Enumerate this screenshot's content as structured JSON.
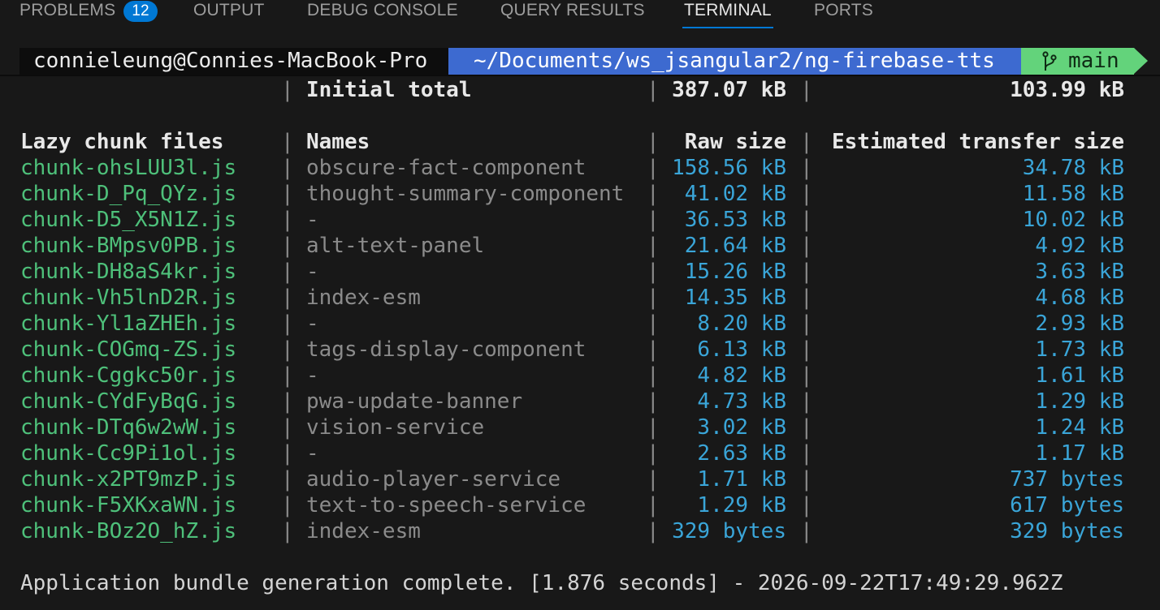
{
  "panel": {
    "tabs": [
      {
        "label": "PROBLEMS",
        "badge": "12",
        "active": false
      },
      {
        "label": "OUTPUT",
        "active": false
      },
      {
        "label": "DEBUG CONSOLE",
        "active": false
      },
      {
        "label": "QUERY RESULTS",
        "active": false
      },
      {
        "label": "TERMINAL",
        "active": true
      },
      {
        "label": "PORTS",
        "active": false
      }
    ]
  },
  "prompt": {
    "user_host": "connieleung@Connies-MacBook-Pro",
    "path": "~/Documents/ws_jsangular2/ng-firebase-tts",
    "branch_icon": "git-branch-icon",
    "branch": "main"
  },
  "build": {
    "initial_total": {
      "label": "Initial total",
      "raw": "387.07 kB",
      "transfer": "103.99 kB"
    },
    "lazy_headers": {
      "files": "Lazy chunk files",
      "names": "Names",
      "raw": "Raw size",
      "transfer": "Estimated transfer size"
    },
    "lazy_rows": [
      {
        "file": "chunk-ohsLUU3l.js",
        "name": "obscure-fact-component",
        "raw": "158.56 kB",
        "transfer": "34.78 kB"
      },
      {
        "file": "chunk-D_Pq_QYz.js",
        "name": "thought-summary-component",
        "raw": "41.02 kB",
        "transfer": "11.58 kB"
      },
      {
        "file": "chunk-D5_X5N1Z.js",
        "name": "-",
        "raw": "36.53 kB",
        "transfer": "10.02 kB"
      },
      {
        "file": "chunk-BMpsv0PB.js",
        "name": "alt-text-panel",
        "raw": "21.64 kB",
        "transfer": "4.92 kB"
      },
      {
        "file": "chunk-DH8aS4kr.js",
        "name": "-",
        "raw": "15.26 kB",
        "transfer": "3.63 kB"
      },
      {
        "file": "chunk-Vh5lnD2R.js",
        "name": "index-esm",
        "raw": "14.35 kB",
        "transfer": "4.68 kB"
      },
      {
        "file": "chunk-Yl1aZHEh.js",
        "name": "-",
        "raw": "8.20 kB",
        "transfer": "2.93 kB"
      },
      {
        "file": "chunk-COGmq-ZS.js",
        "name": "tags-display-component",
        "raw": "6.13 kB",
        "transfer": "1.73 kB"
      },
      {
        "file": "chunk-Cggkc50r.js",
        "name": "-",
        "raw": "4.82 kB",
        "transfer": "1.61 kB"
      },
      {
        "file": "chunk-CYdFyBqG.js",
        "name": "pwa-update-banner",
        "raw": "4.73 kB",
        "transfer": "1.29 kB"
      },
      {
        "file": "chunk-DTq6w2wW.js",
        "name": "vision-service",
        "raw": "3.02 kB",
        "transfer": "1.24 kB"
      },
      {
        "file": "chunk-Cc9Pi1ol.js",
        "name": "-",
        "raw": "2.63 kB",
        "transfer": "1.17 kB"
      },
      {
        "file": "chunk-x2PT9mzP.js",
        "name": "audio-player-service",
        "raw": "1.71 kB",
        "transfer": "737 bytes"
      },
      {
        "file": "chunk-F5XKxaWN.js",
        "name": "text-to-speech-service",
        "raw": "1.29 kB",
        "transfer": "617 bytes"
      },
      {
        "file": "chunk-BOz2O_hZ.js",
        "name": "index-esm",
        "raw": "329 bytes",
        "transfer": "329 bytes"
      }
    ],
    "completion": "Application bundle generation complete. [1.876 seconds] - 2026-09-22T17:49:29.962Z"
  },
  "colors": {
    "background": "#181818",
    "accent": "#0078d4",
    "file": "#4ec07a",
    "size": "#3aa5d8",
    "name": "#8b8b8b",
    "prompt_path": "#3d6ad0",
    "prompt_branch": "#63d37b"
  }
}
